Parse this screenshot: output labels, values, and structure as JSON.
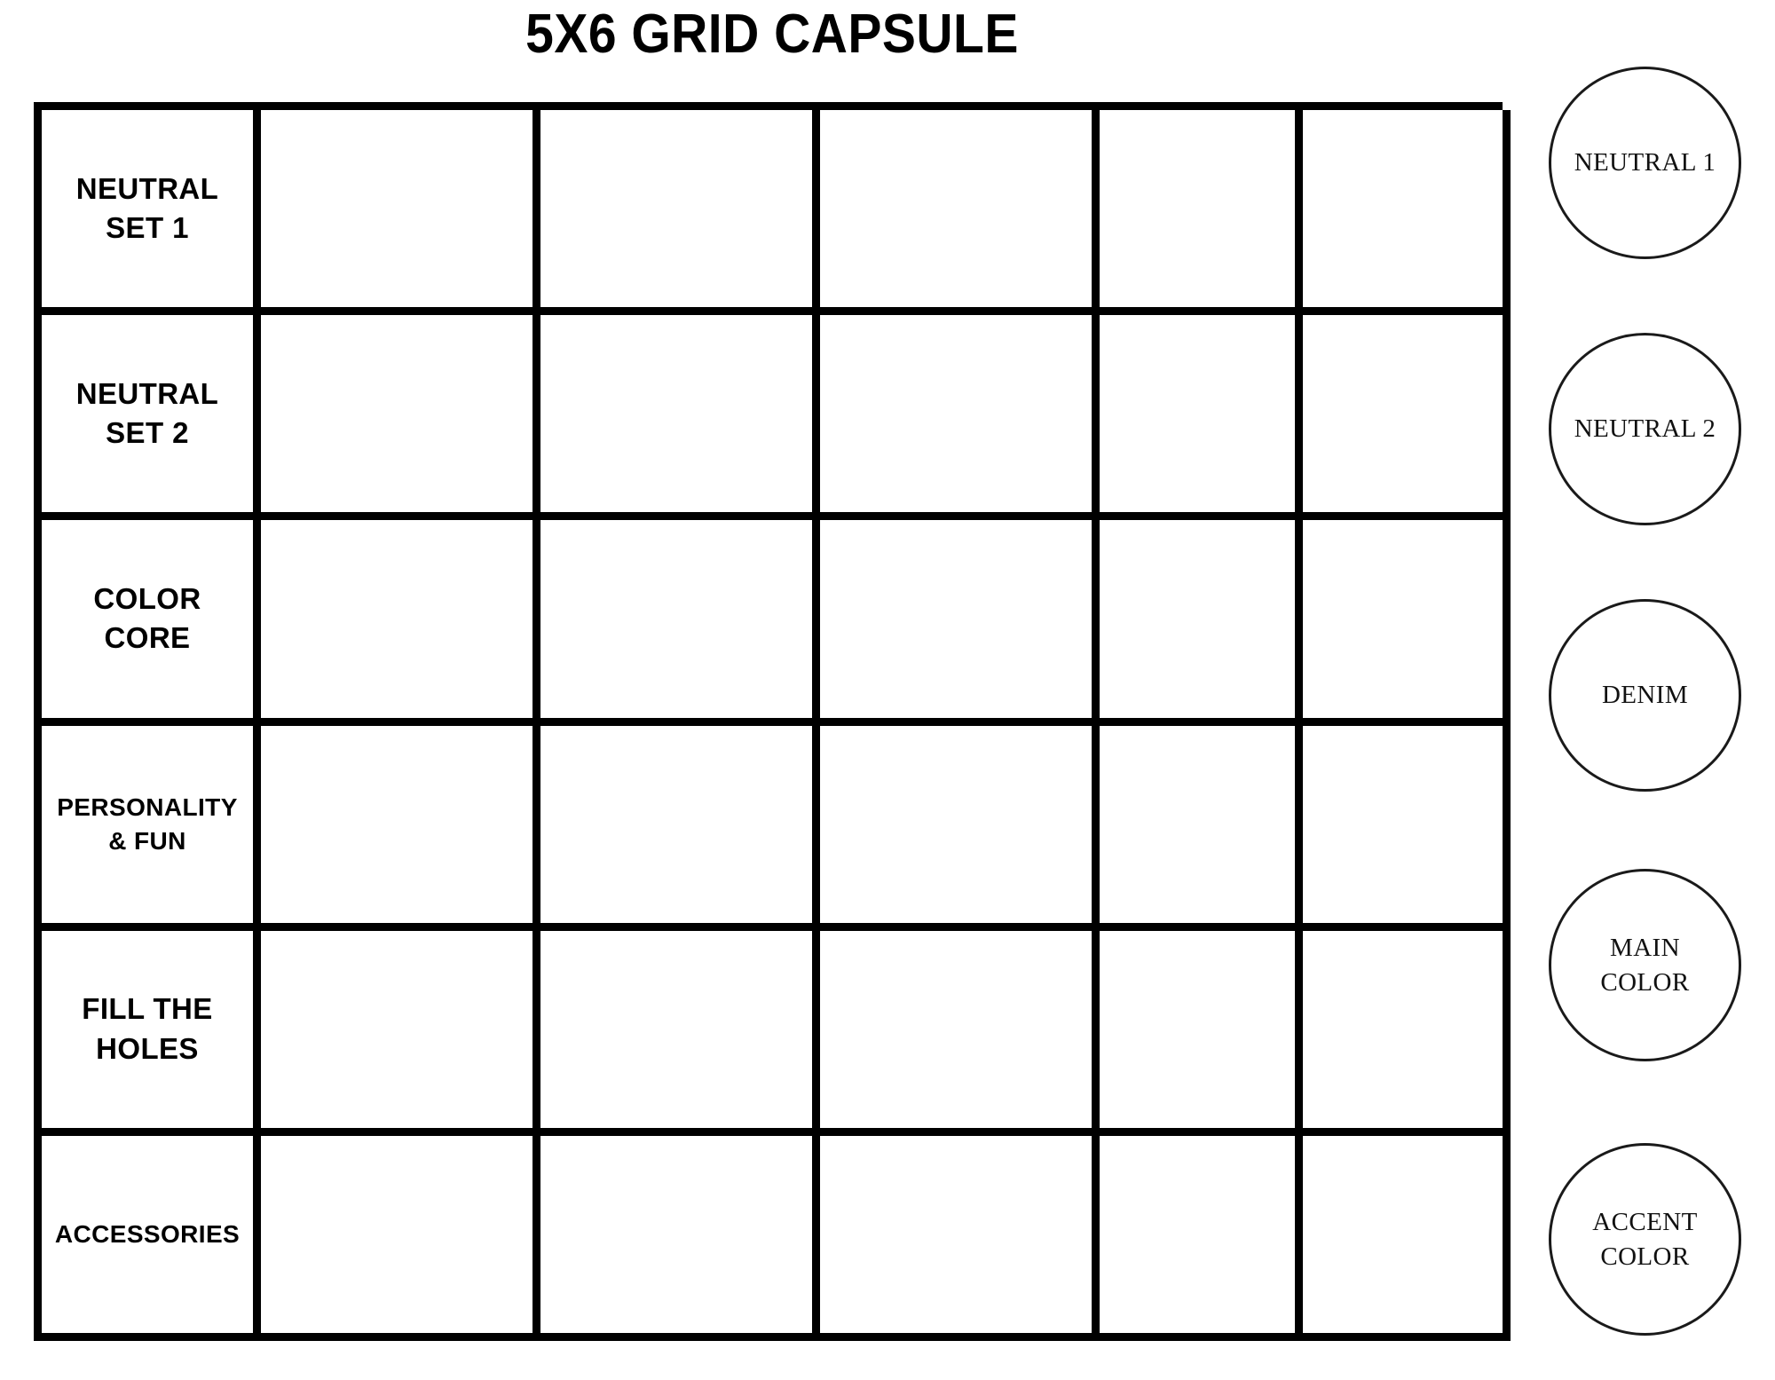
{
  "page": {
    "title": "5X6 GRID CAPSULE",
    "background_color": "#ffffff",
    "ink_color": "#000000"
  },
  "grid": {
    "columns": 6,
    "rows": 6,
    "filled_columns": 1,
    "empty_columns": 5,
    "rows_data": [
      {
        "label": "NEUTRAL\nSET 1",
        "size": "normal",
        "cells": [
          "",
          "",
          "",
          "",
          ""
        ]
      },
      {
        "label": "NEUTRAL\nSET 2",
        "size": "normal",
        "cells": [
          "",
          "",
          "",
          "",
          ""
        ]
      },
      {
        "label": "COLOR\nCORE",
        "size": "normal",
        "cells": [
          "",
          "",
          "",
          "",
          ""
        ]
      },
      {
        "label": "PERSONALITY\n& FUN",
        "size": "small",
        "cells": [
          "",
          "",
          "",
          "",
          ""
        ]
      },
      {
        "label": "FILL THE\nHOLES",
        "size": "normal",
        "cells": [
          "",
          "",
          "",
          "",
          ""
        ]
      },
      {
        "label": "ACCESSORIES",
        "size": "small",
        "cells": [
          "",
          "",
          "",
          "",
          ""
        ]
      }
    ]
  },
  "swatches": {
    "items": [
      {
        "label": "NEUTRAL 1"
      },
      {
        "label": "NEUTRAL 2"
      },
      {
        "label": "DENIM"
      },
      {
        "label": "MAIN\nCOLOR"
      },
      {
        "label": "ACCENT\nCOLOR"
      }
    ]
  }
}
